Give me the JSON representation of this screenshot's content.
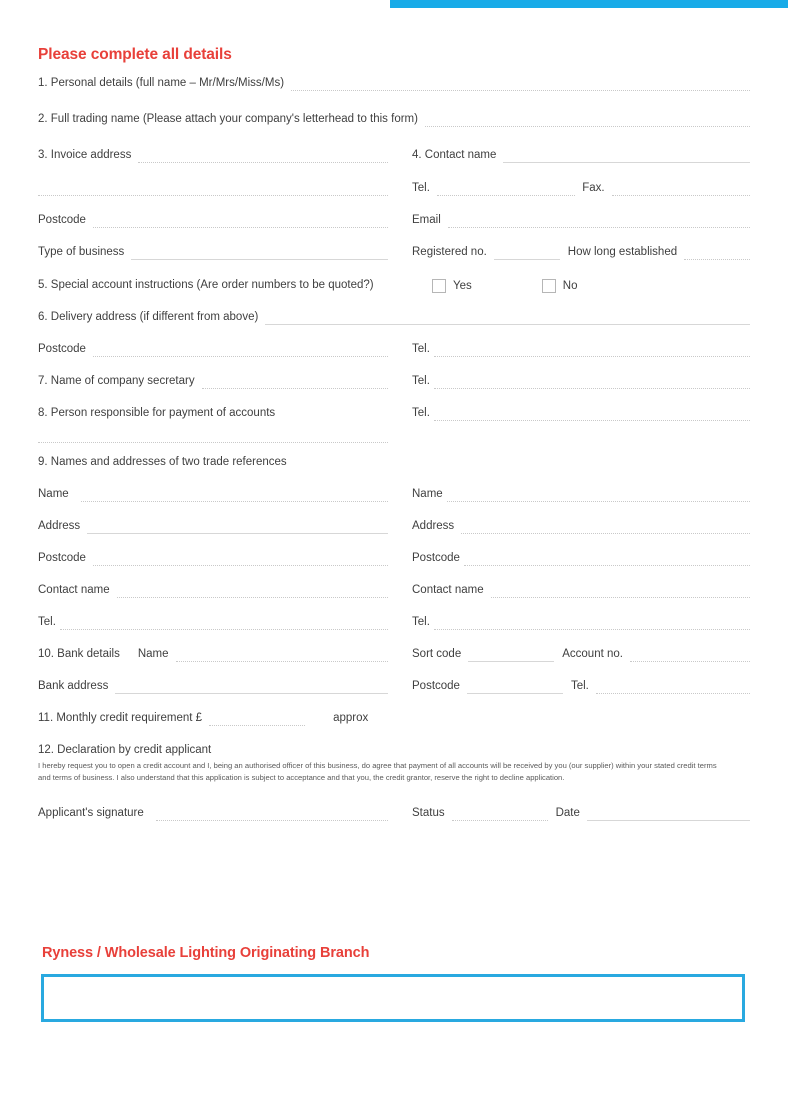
{
  "colors": {
    "accent_blue": "#18ABE8",
    "box_blue": "#29A9E0",
    "heading_red": "#e8403a",
    "line_gray": "#c9c9c9"
  },
  "heading": "Please complete all details",
  "fields": {
    "personal_details": "1. Personal details (full name – Mr/Mrs/Miss/Ms)",
    "full_trading_name": "2. Full trading name  (Please attach your company's letterhead to this form)",
    "invoice_address": "3. Invoice address",
    "contact_name_4": "4. Contact name",
    "tel": "Tel.",
    "fax": "Fax.",
    "postcode": "Postcode",
    "email": "Email",
    "type_of_business": "Type of business",
    "registered_no": "Registered no.",
    "how_long_established": "How long established",
    "special_instructions": "5. Special account instructions (Are order numbers to be quoted?)",
    "yes": "Yes",
    "no": "No",
    "delivery_address": "6. Delivery address (if different from above)",
    "company_secretary": "7.  Name of company secretary",
    "person_responsible": "8. Person responsible for payment of accounts",
    "trade_references": "9. Names and addresses of two trade references",
    "name": "Name",
    "address": "Address",
    "contact_name": "Contact name",
    "bank_details": "10. Bank details",
    "bank_name": "Name",
    "sort_code": "Sort code",
    "account_no": "Account no.",
    "bank_address": "Bank address",
    "monthly_credit": "11. Monthly credit requirement £",
    "approx": "approx",
    "declaration_title": "12. Declaration by credit applicant",
    "declaration_body": "I hereby request you to open a credit account and I, being an authorised officer of this business, do agree that payment of all accounts will be received by you (our supplier) within your stated credit terms and terms of business. I also understand that this application is subject to acceptance and that you, the credit grantor, reserve the right to decline application.",
    "applicants_signature": "Applicant's signature",
    "status": "Status",
    "date": "Date"
  },
  "branch": {
    "title": "Ryness / Wholesale Lighting Originating Branch",
    "value": ""
  }
}
